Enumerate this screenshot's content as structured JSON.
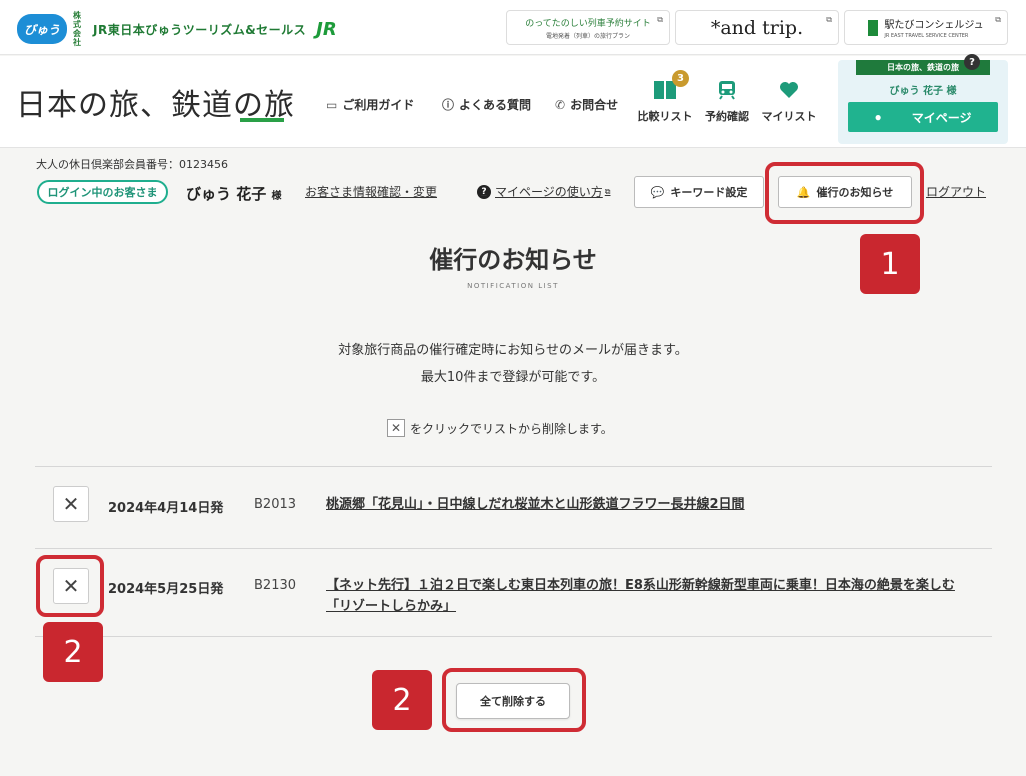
{
  "topbar": {
    "view_logo": "びゅう",
    "company_small": "株式会社",
    "company_name": "JR東日本びゅうツーリズム&セールス",
    "jr_logo": "JR",
    "ext1_main": "のってたのしい列車予約サイト",
    "ext1_sub": "電地発着（列車）の旅行プラン",
    "ext2_main": "*and trip.",
    "ext3_main": "駅たびコンシェルジュ",
    "ext3_sub": "JR EAST TRAVEL SERVICE CENTER"
  },
  "header": {
    "site_logo": "日本の旅、鉄道の旅",
    "nav_guide": "ご利用ガイド",
    "nav_faq": "よくある質問",
    "nav_contact": "お問合せ",
    "compare_label": "比較リスト",
    "compare_count": "3",
    "reservation_label": "予約確認",
    "mylist_label": "マイリスト",
    "panel_ribbon": "日本の旅、鉄道の旅",
    "panel_help": "?",
    "panel_user": "びゅう 花子 様",
    "mypage_label": "マイページ"
  },
  "member": {
    "number_text": "大人の休日倶楽部会員番号：0123456",
    "login_badge": "ログイン中のお客さま",
    "user_name": "びゅう 花子",
    "honorific": "様",
    "info_link": "お客さま情報確認・変更",
    "help_link": "マイページの使い方",
    "keyword_btn": "キーワード設定",
    "notify_btn": "催行のお知らせ",
    "logout_link": "ログアウト"
  },
  "main": {
    "title": "催行のお知らせ",
    "subtitle": "NOTIFICATION LIST",
    "desc_line1": "対象旅行商品の催行確定時にお知らせのメールが届きます。",
    "desc_line2": "最大10件まで登録が可能です。",
    "hint_text": "をクリックでリストから削除します。",
    "delete_all": "全て削除する"
  },
  "rows": [
    {
      "date": "2024年4月14日発",
      "code": "B2013",
      "title": "桃源郷「花見山」・日中線しだれ桜並木と山形鉄道フラワー長井線2日間"
    },
    {
      "date": "2024年5月25日発",
      "code": "B2130",
      "title": "【ネット先行】１泊２日で楽しむ東日本列車の旅！E8系山形新幹線新型車両に乗車！日本海の絶景を楽しむ「リゾートしらかみ」"
    }
  ],
  "annotations": {
    "n1": "1",
    "n2a": "2",
    "n2b": "2"
  },
  "colors": {
    "accent_green": "#20b38f",
    "annotation_red": "#cf2c34",
    "brand_green": "#1f7a3c"
  },
  "icons": {
    "close": "close-icon",
    "bell": "bell-icon",
    "chat": "chat-icon",
    "book": "book-icon",
    "heart": "heart-icon",
    "train": "train-icon",
    "user": "user-icon"
  }
}
